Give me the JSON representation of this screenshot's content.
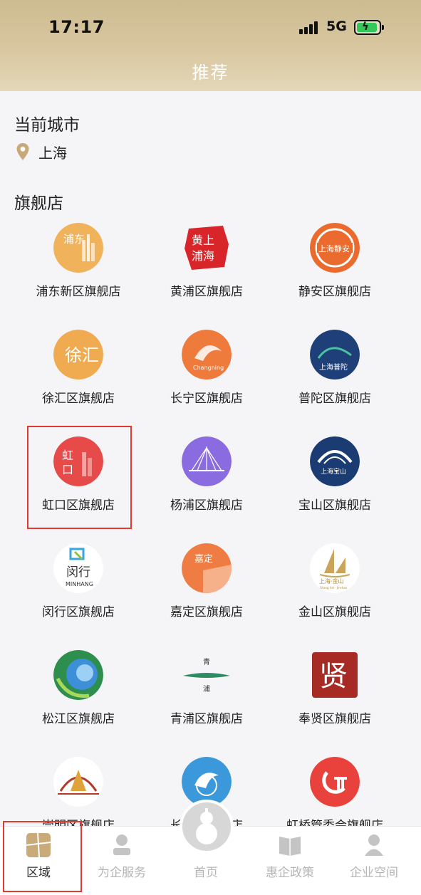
{
  "status_bar": {
    "time": "17:17",
    "network": "5G"
  },
  "header": {
    "title": "推荐"
  },
  "current_city": {
    "section_title": "当前城市",
    "city": "上海"
  },
  "flagship": {
    "section_title": "旗舰店",
    "stores": [
      {
        "label": "浦东新区旗舰店",
        "logo_icon": "pudong-logo-icon",
        "logo_text": "浦东"
      },
      {
        "label": "黄浦区旗舰店",
        "logo_icon": "huangpu-logo-icon",
        "logo_text": "黄浦上海"
      },
      {
        "label": "静安区旗舰店",
        "logo_icon": "jingan-logo-icon",
        "logo_text": "上海静安"
      },
      {
        "label": "徐汇区旗舰店",
        "logo_icon": "xuhui-logo-icon",
        "logo_text": "徐汇"
      },
      {
        "label": "长宁区旗舰店",
        "logo_icon": "changning-logo-icon",
        "logo_text": "Changning"
      },
      {
        "label": "普陀区旗舰店",
        "logo_icon": "putuo-logo-icon",
        "logo_text": "上海普陀"
      },
      {
        "label": "虹口区旗舰店",
        "logo_icon": "hongkou-logo-icon",
        "logo_text": "虹口"
      },
      {
        "label": "杨浦区旗舰店",
        "logo_icon": "yangpu-logo-icon",
        "logo_text": ""
      },
      {
        "label": "宝山区旗舰店",
        "logo_icon": "baoshan-logo-icon",
        "logo_text": "上海宝山"
      },
      {
        "label": "闵行区旗舰店",
        "logo_icon": "minhang-logo-icon",
        "logo_text": "闵行",
        "logo_sub": "MINHANG"
      },
      {
        "label": "嘉定区旗舰店",
        "logo_icon": "jiading-logo-icon",
        "logo_text": "嘉定"
      },
      {
        "label": "金山区旗舰店",
        "logo_icon": "jinshan-logo-icon",
        "logo_text": "上海·金山",
        "logo_sub": "Shang hai · Jinshan"
      },
      {
        "label": "松江区旗舰店",
        "logo_icon": "songjiang-logo-icon",
        "logo_text": ""
      },
      {
        "label": "青浦区旗舰店",
        "logo_icon": "qingpu-logo-icon",
        "logo_text": "青浦"
      },
      {
        "label": "奉贤区旗舰店",
        "logo_icon": "fengxian-logo-icon",
        "logo_text": "贤"
      },
      {
        "label": "崇明区旗舰店",
        "logo_icon": "chongming-logo-icon",
        "logo_text": ""
      },
      {
        "label": "长宁区旗舰店",
        "logo_icon": "dolphin-logo-icon",
        "logo_text": ""
      },
      {
        "label": "虹桥管委会旗舰店",
        "logo_icon": "hongqiao-logo-icon",
        "logo_text": ""
      }
    ]
  },
  "tabbar": {
    "tabs": [
      {
        "label": "区域",
        "icon": "region-icon",
        "active": true
      },
      {
        "label": "为企服务",
        "icon": "enterprise-service-icon",
        "active": false
      },
      {
        "label": "首页",
        "icon": "home-gourd-icon",
        "active": false
      },
      {
        "label": "惠企政策",
        "icon": "policy-book-icon",
        "active": false
      },
      {
        "label": "企业空间",
        "icon": "enterprise-space-icon",
        "active": false
      }
    ]
  },
  "colors": {
    "accent": "#cdbb91",
    "highlight": "#e23a2f",
    "inactive_tab": "#b5b5b5"
  }
}
